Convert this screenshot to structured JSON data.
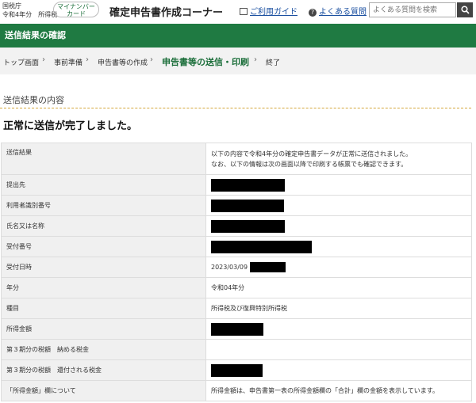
{
  "header": {
    "org_line1": "国税庁",
    "org_line2": "令和4年分　所得税",
    "mynumber_line1": "マイナンバー",
    "mynumber_line2": "カード",
    "title": "確定申告書作成コーナー",
    "guide_link": "ご利用ガイド",
    "faq_link": "よくある質問",
    "search_placeholder": "よくある質問を検索"
  },
  "page_title": "送信結果の確認",
  "breadcrumb": [
    "トップ画面",
    "事前準備",
    "申告書等の作成",
    "申告書等の送信・印刷",
    "終了"
  ],
  "section_title": "送信結果の内容",
  "done_message": "正常に送信が完了しました。",
  "rows": [
    {
      "label": "送信結果",
      "value_line1": "以下の内容で令和4年分の確定申告書データが正常に送信されました。",
      "value_line2": "なお、以下の情報は次の画面以降で印刷する帳票でも確認できます。"
    },
    {
      "label": "提出先",
      "value": ""
    },
    {
      "label": "利用者識別番号",
      "value": ""
    },
    {
      "label": "氏名又は名称",
      "value": ""
    },
    {
      "label": "受付番号",
      "value": ""
    },
    {
      "label": "受付日時",
      "value": "2023/03/09"
    },
    {
      "label": "年分",
      "value": "令和04年分"
    },
    {
      "label": "種目",
      "value": "所得税及び復興特別所得税"
    },
    {
      "label": "所得金額",
      "value": ""
    },
    {
      "label": "第３期分の税額　納める税金",
      "value": ""
    },
    {
      "label": "第３期分の税額　還付される税金",
      "value": ""
    },
    {
      "label": "「所得金額」欄について",
      "value": "所得金額は、申告書第一表の所得金額欄の「合計」欄の金額を表示しています。"
    }
  ],
  "colors": {
    "brand_green": "#1f7a42",
    "link_blue": "#1a4fa0",
    "redaction": "#000000"
  }
}
